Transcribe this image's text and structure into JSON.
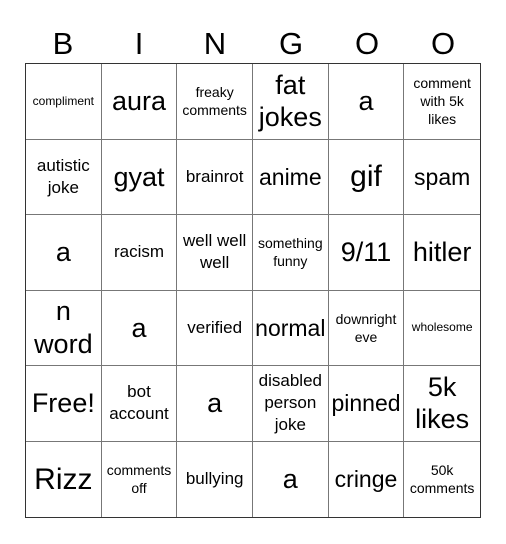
{
  "header": {
    "letters": [
      "B",
      "I",
      "N",
      "G",
      "O",
      "O"
    ]
  },
  "board": {
    "rows": [
      [
        "compliment",
        "aura",
        "freaky comments",
        "fat jokes",
        "a",
        "comment with 5k likes"
      ],
      [
        "autistic joke",
        "gyat",
        "brainrot",
        "anime",
        "gif",
        "spam"
      ],
      [
        "a",
        "racism",
        "well well well",
        "something funny",
        "9/11",
        "hitler"
      ],
      [
        "n word",
        "a",
        "verified",
        "normal",
        "downright eve",
        "wholesome"
      ],
      [
        "Free!",
        "bot account",
        "a",
        "disabled person joke",
        "pinned",
        "5k likes"
      ],
      [
        "Rizz",
        "comments off",
        "bullying",
        "a",
        "cringe",
        "50k comments"
      ]
    ]
  }
}
